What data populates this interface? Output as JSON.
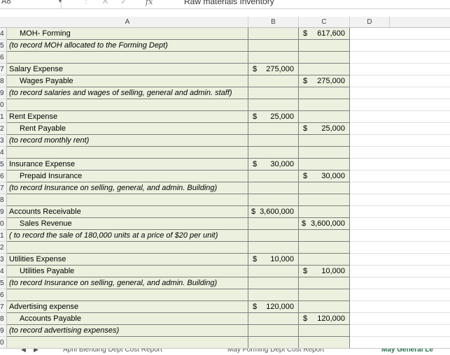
{
  "formula_bar": {
    "name_box": "A8",
    "fx_label": "fx",
    "content": "Raw materials Inventory"
  },
  "columns": [
    "A",
    "B",
    "C",
    "D"
  ],
  "rows": [
    {
      "num": "4",
      "a": "MOH- Forming",
      "a_style": "indent",
      "b_sym": "",
      "b_val": "",
      "c_sym": "$",
      "c_val": "617,600"
    },
    {
      "num": "5",
      "a": "(to record MOH allocated to the Forming Dept)",
      "a_style": "note",
      "b_sym": "",
      "b_val": "",
      "c_sym": "",
      "c_val": ""
    },
    {
      "num": "6",
      "a": "",
      "a_style": "",
      "b_sym": "",
      "b_val": "",
      "c_sym": "",
      "c_val": ""
    },
    {
      "num": "7",
      "a": "Salary Expense",
      "a_style": "",
      "b_sym": "$",
      "b_val": "275,000",
      "c_sym": "",
      "c_val": ""
    },
    {
      "num": "8",
      "a": "Wages Payable",
      "a_style": "indent",
      "b_sym": "",
      "b_val": "",
      "c_sym": "$",
      "c_val": "275,000"
    },
    {
      "num": "9",
      "a": "(to record salaries and wages of selling, general and admin. staff)",
      "a_style": "note",
      "b_sym": "",
      "b_val": "",
      "c_sym": "",
      "c_val": ""
    },
    {
      "num": "0",
      "a": "",
      "a_style": "",
      "b_sym": "",
      "b_val": "",
      "c_sym": "",
      "c_val": ""
    },
    {
      "num": "1",
      "a": "Rent Expense",
      "a_style": "",
      "b_sym": "$",
      "b_val": "25,000",
      "c_sym": "",
      "c_val": ""
    },
    {
      "num": "2",
      "a": "Rent Payable",
      "a_style": "indent",
      "b_sym": "",
      "b_val": "",
      "c_sym": "$",
      "c_val": "25,000"
    },
    {
      "num": "3",
      "a": "(to record monthly rent)",
      "a_style": "note",
      "b_sym": "",
      "b_val": "",
      "c_sym": "",
      "c_val": ""
    },
    {
      "num": "4",
      "a": "",
      "a_style": "",
      "b_sym": "",
      "b_val": "",
      "c_sym": "",
      "c_val": ""
    },
    {
      "num": "5",
      "a": "Insurance Expense",
      "a_style": "",
      "b_sym": "$",
      "b_val": "30,000",
      "c_sym": "",
      "c_val": ""
    },
    {
      "num": "6",
      "a": "Prepaid Insurance",
      "a_style": "indent",
      "b_sym": "",
      "b_val": "",
      "c_sym": "$",
      "c_val": "30,000"
    },
    {
      "num": "7",
      "a": "(to record Insurance on selling, general, and admin. Building)",
      "a_style": "note",
      "b_sym": "",
      "b_val": "",
      "c_sym": "",
      "c_val": ""
    },
    {
      "num": "8",
      "a": "",
      "a_style": "",
      "b_sym": "",
      "b_val": "",
      "c_sym": "",
      "c_val": ""
    },
    {
      "num": "9",
      "a": "Accounts Receivable",
      "a_style": "",
      "b_sym": "$",
      "b_val": "3,600,000",
      "c_sym": "",
      "c_val": "",
      "big": true
    },
    {
      "num": "0",
      "a": "Sales Revenue",
      "a_style": "indent",
      "b_sym": "",
      "b_val": "",
      "c_sym": "$",
      "c_val": "3,600,000",
      "big": true
    },
    {
      "num": "1",
      "a": "( to record the sale of 180,000 units at a price of $20 per unit)",
      "a_style": "note",
      "b_sym": "",
      "b_val": "",
      "c_sym": "",
      "c_val": ""
    },
    {
      "num": "2",
      "a": "",
      "a_style": "",
      "b_sym": "",
      "b_val": "",
      "c_sym": "",
      "c_val": ""
    },
    {
      "num": "3",
      "a": "Utilities Expense",
      "a_style": "",
      "b_sym": "$",
      "b_val": "10,000",
      "c_sym": "",
      "c_val": ""
    },
    {
      "num": "4",
      "a": "Utilities Payable",
      "a_style": "indent",
      "b_sym": "",
      "b_val": "",
      "c_sym": "$",
      "c_val": "10,000"
    },
    {
      "num": "5",
      "a": "(to record Insurance on selling, general, and admin. Building)",
      "a_style": "note",
      "b_sym": "",
      "b_val": "",
      "c_sym": "",
      "c_val": ""
    },
    {
      "num": "6",
      "a": "",
      "a_style": "",
      "b_sym": "",
      "b_val": "",
      "c_sym": "",
      "c_val": ""
    },
    {
      "num": "7",
      "a": "Advertising expense",
      "a_style": "",
      "b_sym": "$",
      "b_val": "120,000",
      "c_sym": "",
      "c_val": ""
    },
    {
      "num": "8",
      "a": "Accounts Payable",
      "a_style": "indent",
      "b_sym": "",
      "b_val": "",
      "c_sym": "$",
      "c_val": "120,000"
    },
    {
      "num": "9",
      "a": "(to record advertising expenses)",
      "a_style": "note",
      "b_sym": "",
      "b_val": "",
      "c_sym": "",
      "c_val": ""
    },
    {
      "num": "0",
      "a": "",
      "a_style": "",
      "b_sym": "",
      "b_val": "",
      "c_sym": "",
      "c_val": ""
    }
  ],
  "sheet_tabs": [
    {
      "label": "April Blending Dept Cost Report",
      "active": false
    },
    {
      "label": "May Forming Dept Cost Report",
      "active": false
    },
    {
      "label": "May General Le",
      "active": true
    }
  ],
  "colors": {
    "cell_fill": "#ebf1de",
    "active_tab": "#217346"
  }
}
